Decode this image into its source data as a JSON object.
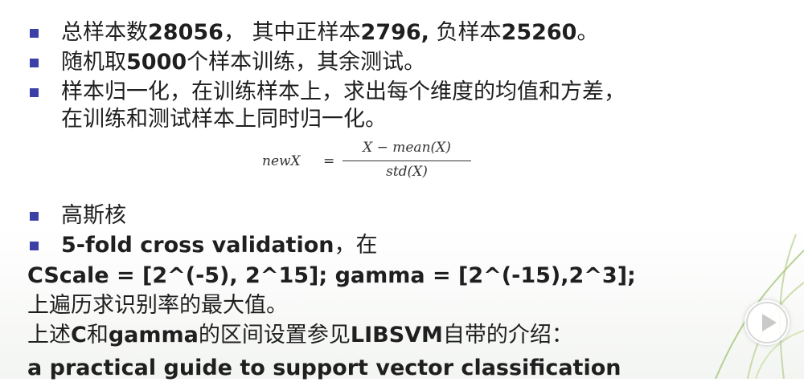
{
  "bullets": [
    {
      "parts": [
        {
          "text": "总样本数",
          "bold": false
        },
        {
          "text": "28056",
          "bold": true
        },
        {
          "text": "， 其中正样本",
          "bold": false
        },
        {
          "text": "2796,",
          "bold": true
        },
        {
          "text": " 负样本",
          "bold": false
        },
        {
          "text": "25260",
          "bold": true
        },
        {
          "text": "。",
          "bold": false
        }
      ]
    },
    {
      "parts": [
        {
          "text": "随机取",
          "bold": false
        },
        {
          "text": "5000",
          "bold": true
        },
        {
          "text": "个样本训练，其余测试。",
          "bold": false
        }
      ]
    },
    {
      "parts": [
        {
          "text": "样本归一化，在训练样本上，求出每个维度的均值和方差，",
          "bold": false
        }
      ],
      "continuation": "在训练和测试样本上同时归一化。"
    },
    {
      "parts": [
        {
          "text": "高斯核",
          "bold": false
        }
      ]
    },
    {
      "parts": [
        {
          "text": "5-fold cross validation",
          "bold": true
        },
        {
          "text": "，在",
          "bold": false
        }
      ]
    }
  ],
  "formula": {
    "lhs": "newX",
    "eq": "=",
    "numerator": "X − mean(X)",
    "denominator": "std(X)"
  },
  "plain_lines": [
    [
      {
        "text": "CScale = [2^(-5), 2^15];  gamma = [2^(-15),2^3];",
        "bold": true
      }
    ],
    [
      {
        "text": "上遍历求识别率的最大值。",
        "bold": false
      }
    ],
    [
      {
        "text": "上述",
        "bold": false
      },
      {
        "text": "C",
        "bold": true
      },
      {
        "text": "和",
        "bold": false
      },
      {
        "text": "gamma",
        "bold": true
      },
      {
        "text": "的区间设置参见",
        "bold": false
      },
      {
        "text": "LIBSVM",
        "bold": true
      },
      {
        "text": "自带的介绍：",
        "bold": false
      }
    ],
    [
      {
        "text": "a practical guide to support vector classification",
        "bold": true
      }
    ]
  ],
  "colors": {
    "bullet": "#3b3fa6",
    "text": "#1f1f1f"
  },
  "icons": {
    "play": "play-icon"
  }
}
